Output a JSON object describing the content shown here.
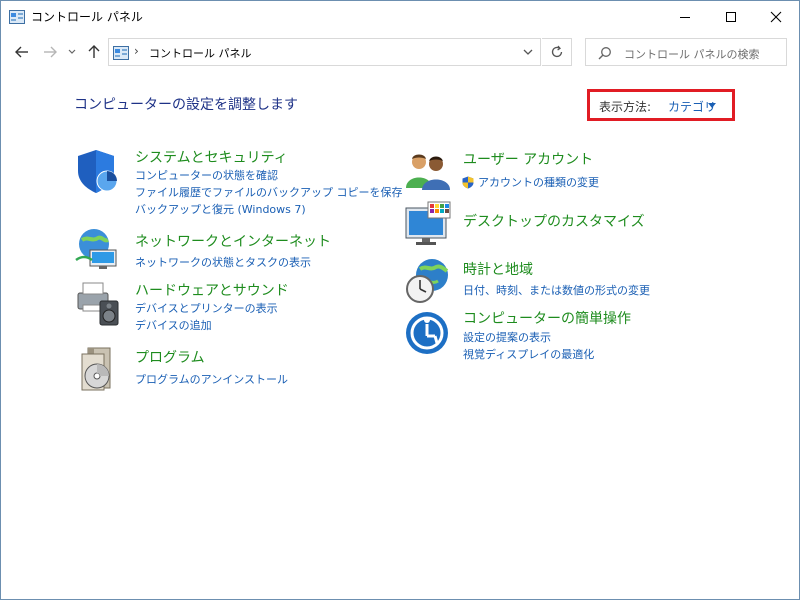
{
  "window": {
    "title": "コントロール パネル"
  },
  "navbar": {
    "breadcrumb_separator": "›",
    "address_text": "コントロール パネル",
    "search_placeholder": "コントロール パネルの検索"
  },
  "main": {
    "heading": "コンピューターの設定を調整します",
    "view_by": {
      "label": "表示方法:",
      "value": "カテゴリ"
    },
    "categories": [
      {
        "title": "システムとセキュリティ",
        "icon": "shield-icon",
        "links": [
          "コンピューターの状態を確認",
          "ファイル履歴でファイルのバックアップ コピーを保存",
          "バックアップと復元 (Windows 7)"
        ]
      },
      {
        "title": "ネットワークとインターネット",
        "icon": "network-globe-icon",
        "links": [
          "ネットワークの状態とタスクの表示"
        ]
      },
      {
        "title": "ハードウェアとサウンド",
        "icon": "printer-speaker-icon",
        "links": [
          "デバイスとプリンターの表示",
          "デバイスの追加"
        ]
      },
      {
        "title": "プログラム",
        "icon": "programs-disc-icon",
        "links": [
          "プログラムのアンインストール"
        ]
      },
      {
        "title": "ユーザー アカウント",
        "icon": "users-icon",
        "links": [
          "アカウントの種類の変更"
        ]
      },
      {
        "title": "デスクトップのカスタマイズ",
        "icon": "monitor-palette-icon",
        "links": []
      },
      {
        "title": "時計と地域",
        "icon": "clock-globe-icon",
        "links": [
          "日付、時刻、または数値の形式の変更"
        ]
      },
      {
        "title": "コンピューターの簡単操作",
        "icon": "ease-of-access-icon",
        "links": [
          "設定の提案の表示",
          "視覚ディスプレイの最適化"
        ]
      }
    ]
  },
  "colors": {
    "category_title": "#1e8c1e",
    "link": "#1a5fb4",
    "heading": "#1e3287",
    "highlight_border": "#e11c24"
  }
}
